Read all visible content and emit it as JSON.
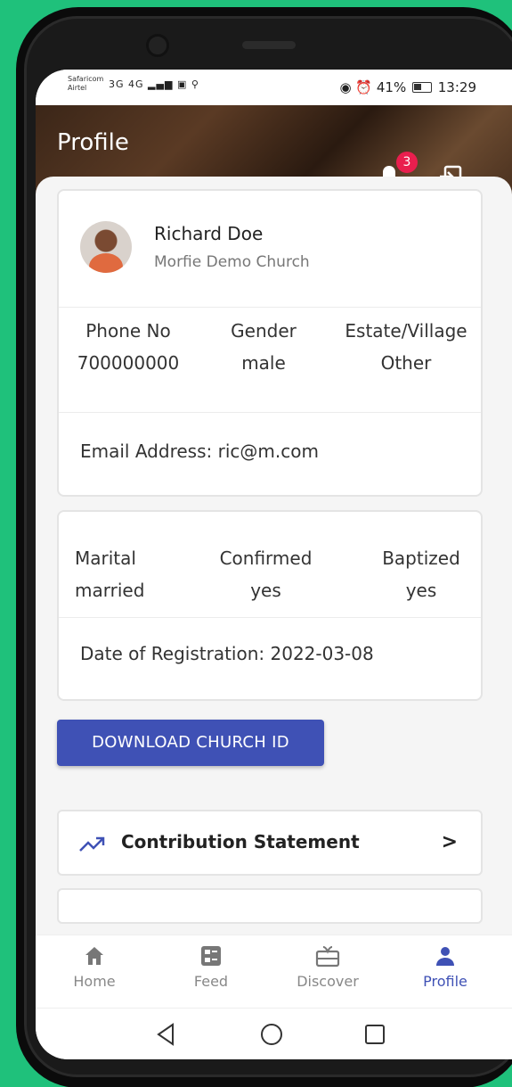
{
  "status_bar": {
    "carrier_primary": "Safaricom",
    "carrier_secondary": "Airtel",
    "network": "3G 4G",
    "battery": "41%",
    "time": "13:29"
  },
  "header": {
    "title": "Profile",
    "notification_count": "3"
  },
  "profile": {
    "name": "Richard Doe",
    "church": "Morfie Demo Church",
    "fields": [
      {
        "label": "Phone No",
        "value": "700000000"
      },
      {
        "label": "Gender",
        "value": "male"
      },
      {
        "label": "Estate/Village",
        "value": "Other"
      }
    ],
    "email": "Email Address: ric@m.com"
  },
  "membership": {
    "fields": [
      {
        "label": "Marital",
        "value": "married"
      },
      {
        "label": "Confirmed",
        "value": "yes"
      },
      {
        "label": "Baptized",
        "value": "yes"
      }
    ],
    "registration": "Date of Registration: 2022-03-08"
  },
  "download_button": "DOWNLOAD CHURCH ID",
  "contribution": {
    "label": "Contribution Statement",
    "chevron": ">"
  },
  "bottom_nav": [
    {
      "label": "Home",
      "icon": "home-icon"
    },
    {
      "label": "Feed",
      "icon": "feed-icon"
    },
    {
      "label": "Discover",
      "icon": "discover-icon"
    },
    {
      "label": "Profile",
      "icon": "profile-icon"
    }
  ],
  "colors": {
    "accent": "#3f51b5",
    "badge": "#e91e4e",
    "background": "#1fc17b"
  }
}
